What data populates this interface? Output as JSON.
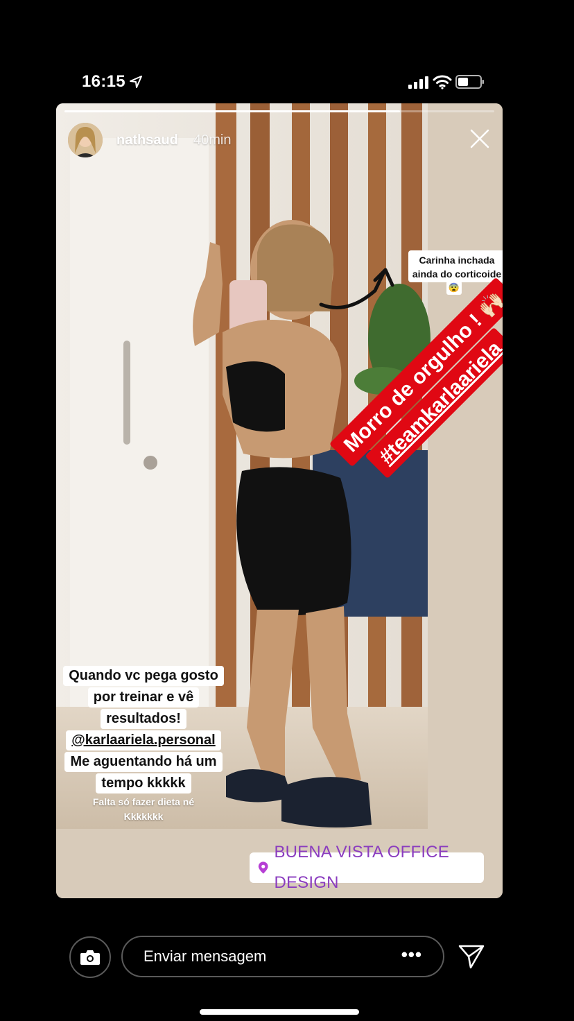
{
  "status_bar": {
    "time": "16:15"
  },
  "story": {
    "progress": 0.78,
    "username": "nathsaud",
    "time_ago": "40min",
    "stickers": {
      "note_line1": "Carinha inchada",
      "note_line2": "ainda do corticoide",
      "emoji": "😨",
      "red_line1": "Morro de orgulho ! 🙌🏻",
      "red_line2": "#teamkarlaariela"
    },
    "caption": {
      "lines": [
        "Quando vc pega gosto",
        "por treinar e vê",
        "resultados!",
        "@karlaariela.personal",
        "Me aguentando há um",
        "tempo kkkkk"
      ],
      "small_lines": [
        "Falta só fazer dieta né",
        "Kkkkkkk"
      ]
    },
    "location": "BUENA VISTA OFFICE DESIGN"
  },
  "bottom_bar": {
    "message_placeholder": "Enviar mensagem",
    "more_label": "•••"
  },
  "colors": {
    "red_sticker": "#e00813",
    "location_text": "#8b3dbf",
    "background": "#000000"
  },
  "icons": [
    "location-arrow-icon",
    "signal-icon",
    "wifi-icon",
    "battery-icon",
    "close-icon",
    "pin-icon",
    "camera-icon",
    "send-icon"
  ]
}
